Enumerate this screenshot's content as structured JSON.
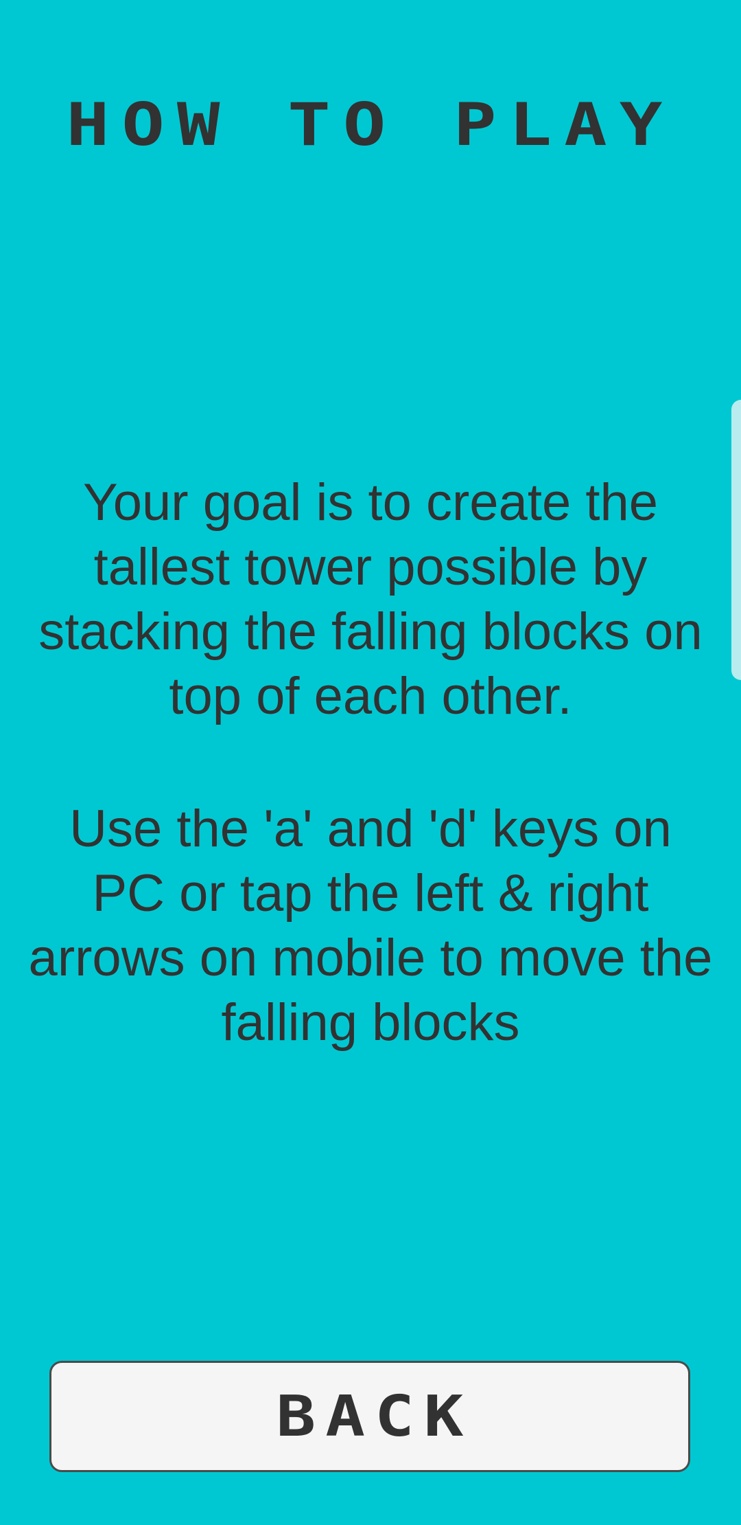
{
  "screen": {
    "title": "HOW TO PLAY",
    "instructions": [
      "Your goal is to create the tallest tower possible by stacking the falling blocks on top of each other.",
      "Use the 'a' and 'd' keys on PC or tap the left & right arrows on mobile to move the falling blocks"
    ],
    "back_label": "BACK"
  },
  "colors": {
    "background": "#00C8D2",
    "text": "#323232",
    "button_fill": "#F5F5F5"
  }
}
